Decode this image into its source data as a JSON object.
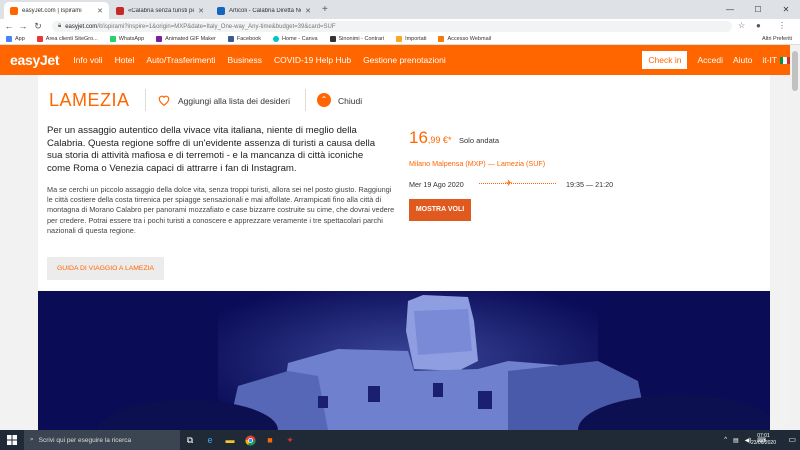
{
  "browser": {
    "tabs": [
      {
        "title": "easyJet.com | Ispirami",
        "active": true,
        "favicon_color": "#ff6600"
      },
      {
        "title": "«Calabria senza turisti per mafia»",
        "active": false,
        "favicon_color": "#c62828"
      },
      {
        "title": "Articoli - Calabria Diretta News -",
        "active": false,
        "favicon_color": "#1565c0"
      }
    ],
    "url_host": "easyjet.com",
    "url_path": "/it/ispirami?inspire=1&origin=MXP&date=Italy_One-way_Any-time&budget=39&card=SUF",
    "bookmarks": [
      {
        "label": "App",
        "color": "#4285f4"
      },
      {
        "label": "Area clienti SiteGro...",
        "color": "#e53935"
      },
      {
        "label": "WhatsApp",
        "color": "#25d366"
      },
      {
        "label": "Animated GIF Maker",
        "color": "#7b1fa2"
      },
      {
        "label": "Facebook",
        "color": "#3b5998"
      },
      {
        "label": "Home - Canva",
        "color": "#00c4cc"
      },
      {
        "label": "Sinonimi - Contrari",
        "color": "#333333"
      },
      {
        "label": "Importati",
        "color": "#f9a825"
      },
      {
        "label": "Accesso Webmail",
        "color": "#f57c00"
      }
    ],
    "other_bookmarks": "Altri Preferiti"
  },
  "nav": {
    "logo": "easyJet",
    "links": [
      "Info voli",
      "Hotel",
      "Auto/Trasferimenti",
      "Business",
      "COVID-19 Help Hub",
      "Gestione prenotazioni"
    ],
    "checkin": "Check in",
    "login": "Accedi",
    "help": "Aiuto",
    "language": "it-IT",
    "brand_color": "#ff6600"
  },
  "destination": {
    "name": "LAMEZIA",
    "wishlist": "Aggiungi alla lista dei desideri",
    "close": "Chiudi",
    "lead": "Per un assaggio autentico della vivace vita italiana, niente di meglio della Calabria. Questa regione soffre di un'evidente assenza di turisti a causa della sua storia di attività mafiosa e di terremoti - e la mancanza di città iconiche come Roma o Venezia capaci di attrarre i fan di Instagram.",
    "body": "Ma se cerchi un piccolo assaggio della dolce vita, senza troppi turisti, allora sei nel posto giusto. Raggiungi le città costiere della costa tirrenica per spiagge sensazionali e mai affollate. Arrampicati fino alla città di montagna di Morano Calabro per panorami mozzafiato e case bizzarre costruite su cime, che dovrai vedere per credere. Potrai essere tra i pochi turisti a conoscere e apprezzare veramente i tre spettacolari parchi nazionali di questa regione.",
    "guide_button": "GUIDA DI VIAGGIO A LAMEZIA"
  },
  "flight": {
    "price_int": "16",
    "price_dec": ",99 €*",
    "price_note": "Solo andata",
    "route": "Milano Malpensa (MXP) — Lamezia (SUF)",
    "date": "Mer 19 Ago 2020",
    "times": "19:35 — 21:20",
    "show_button": "MOSTRA VOLI"
  },
  "taskbar": {
    "search_placeholder": "Scrivi qui per eseguire la ricerca",
    "time": "07:01",
    "date": "23/06/2020"
  }
}
